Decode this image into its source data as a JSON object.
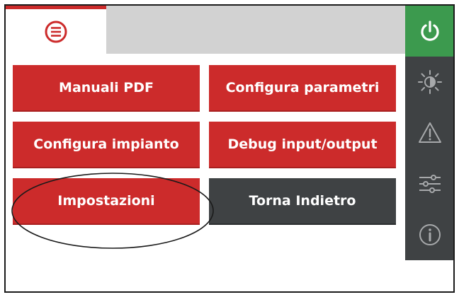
{
  "header": {
    "menu_icon": "menu-icon",
    "power_icon": "power-icon"
  },
  "main": {
    "buttons": [
      {
        "label": "Manuali PDF"
      },
      {
        "label": "Configura parametri"
      },
      {
        "label": "Configura impianto"
      },
      {
        "label": "Debug input/output"
      },
      {
        "label": "Impostazioni"
      },
      {
        "label": "Torna Indietro"
      }
    ]
  },
  "sidebar": {
    "icons": [
      "power-icon",
      "brightness-icon",
      "warning-icon",
      "sliders-icon",
      "info-icon"
    ]
  },
  "colors": {
    "accent_red": "#cc2b2b",
    "power_green": "#3c9a4e",
    "sidebar_dark": "#3f4244",
    "top_bar_gray": "#d2d2d2"
  }
}
